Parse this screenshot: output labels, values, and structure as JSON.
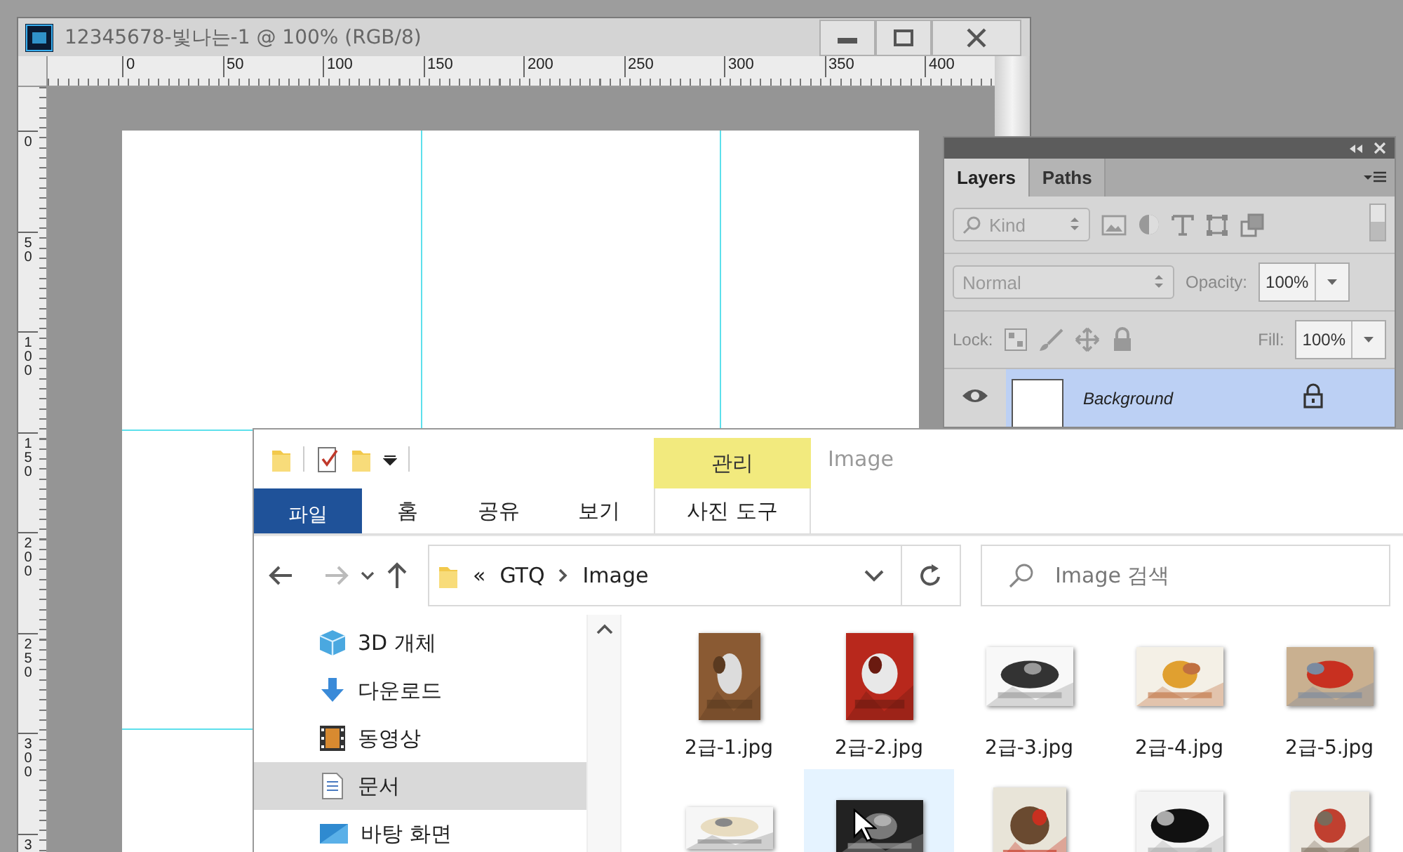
{
  "photoshop": {
    "title": "12345678-빛나는-1 @ 100% (RGB/8)",
    "h_ruler": [
      "0",
      "50",
      "100",
      "150",
      "200",
      "250",
      "300",
      "350",
      "400"
    ],
    "v_ruler": [
      "0",
      "50",
      "100",
      "150",
      "200",
      "250",
      "300",
      "3"
    ]
  },
  "layers_panel": {
    "tabs": [
      {
        "label": "Layers",
        "selected": true
      },
      {
        "label": "Paths",
        "selected": false
      }
    ],
    "filter": {
      "value": "Kind"
    },
    "blend_mode": {
      "value": "Normal"
    },
    "opacity_label": "Opacity:",
    "opacity": "100%",
    "lock_label": "Lock:",
    "fill_label": "Fill:",
    "fill": "100%",
    "layers": [
      {
        "name": "Background",
        "selected": true,
        "visible": true,
        "locked": true
      }
    ]
  },
  "explorer": {
    "context_tab": "관리",
    "title": "Image",
    "ribbon_tabs": [
      {
        "label": "파일",
        "kind": "file"
      },
      {
        "label": "홈",
        "kind": "tab"
      },
      {
        "label": "공유",
        "kind": "tab"
      },
      {
        "label": "보기",
        "kind": "tab"
      },
      {
        "label": "사진 도구",
        "kind": "context"
      }
    ],
    "address": {
      "overflow": "«",
      "path": [
        "GTQ",
        "Image"
      ]
    },
    "search": {
      "placeholder": "Image 검색"
    },
    "nav_items": [
      {
        "label": "3D 개체",
        "kind": "cube",
        "selected": false
      },
      {
        "label": "다운로드",
        "kind": "download",
        "selected": false
      },
      {
        "label": "동영상",
        "kind": "video",
        "selected": false
      },
      {
        "label": "문서",
        "kind": "document",
        "selected": true
      },
      {
        "label": "바탕 화면",
        "kind": "desktop",
        "selected": false
      }
    ],
    "files": [
      {
        "name": "2급-1.jpg",
        "selected": false
      },
      {
        "name": "2급-2.jpg",
        "selected": false
      },
      {
        "name": "2급-3.jpg",
        "selected": false
      },
      {
        "name": "2급-4.jpg",
        "selected": false
      },
      {
        "name": "2급-5.jpg",
        "selected": false
      },
      {
        "selected": false
      },
      {
        "selected": true
      },
      {
        "selected": false
      },
      {
        "selected": false
      },
      {
        "selected": false
      }
    ]
  }
}
